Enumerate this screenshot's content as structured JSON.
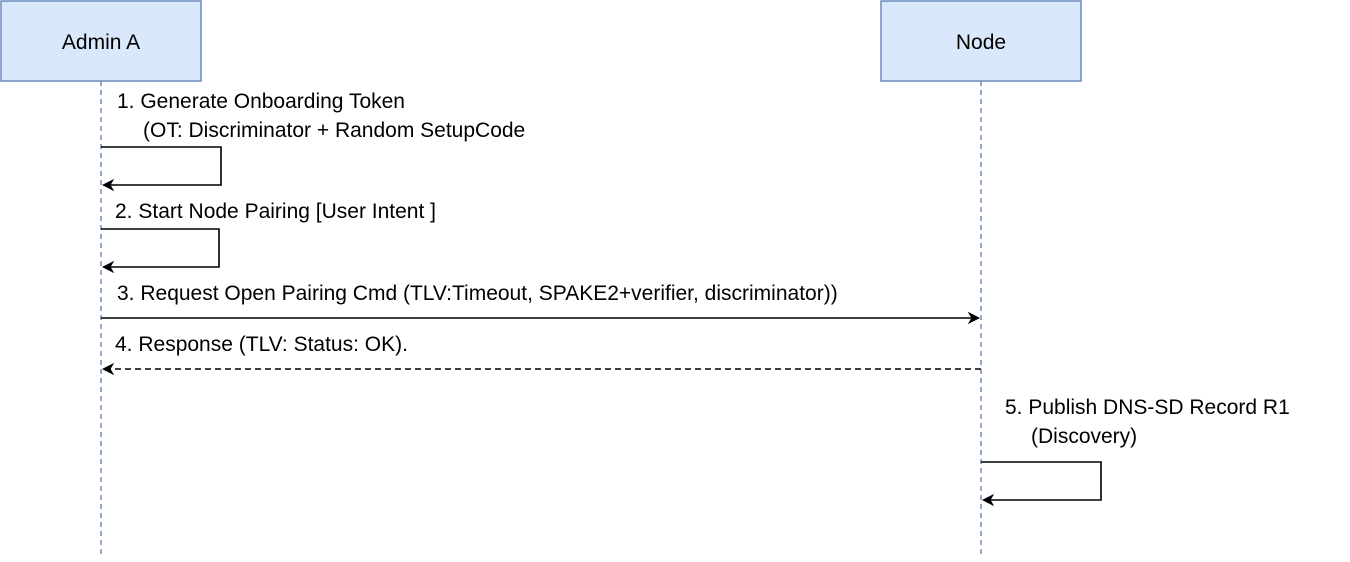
{
  "participants": [
    {
      "name": "Admin A"
    },
    {
      "name": "Node"
    }
  ],
  "messages": [
    {
      "from": "Admin A",
      "to": "Admin A",
      "style": "solid",
      "label_lines": [
        "1. Generate Onboarding Token",
        "(OT: Discriminator + Random SetupCode"
      ]
    },
    {
      "from": "Admin A",
      "to": "Admin A",
      "style": "solid",
      "label_lines": [
        "2. Start Node Pairing [User Intent ]"
      ]
    },
    {
      "from": "Admin A",
      "to": "Node",
      "style": "solid",
      "label_lines": [
        "3. Request Open Pairing Cmd (TLV:Timeout, SPAKE2+verifier, discriminator))"
      ]
    },
    {
      "from": "Node",
      "to": "Admin A",
      "style": "dashed",
      "label_lines": [
        "4. Response (TLV: Status: OK)."
      ]
    },
    {
      "from": "Node",
      "to": "Node",
      "style": "solid",
      "label_lines": [
        "5. Publish DNS-SD Record R1",
        "(Discovery)"
      ]
    }
  ],
  "colors": {
    "participant_fill": "#dae8fc",
    "participant_stroke": "#6c8ebf",
    "lifeline": "#6c8ebf",
    "arrow": "#000000"
  }
}
